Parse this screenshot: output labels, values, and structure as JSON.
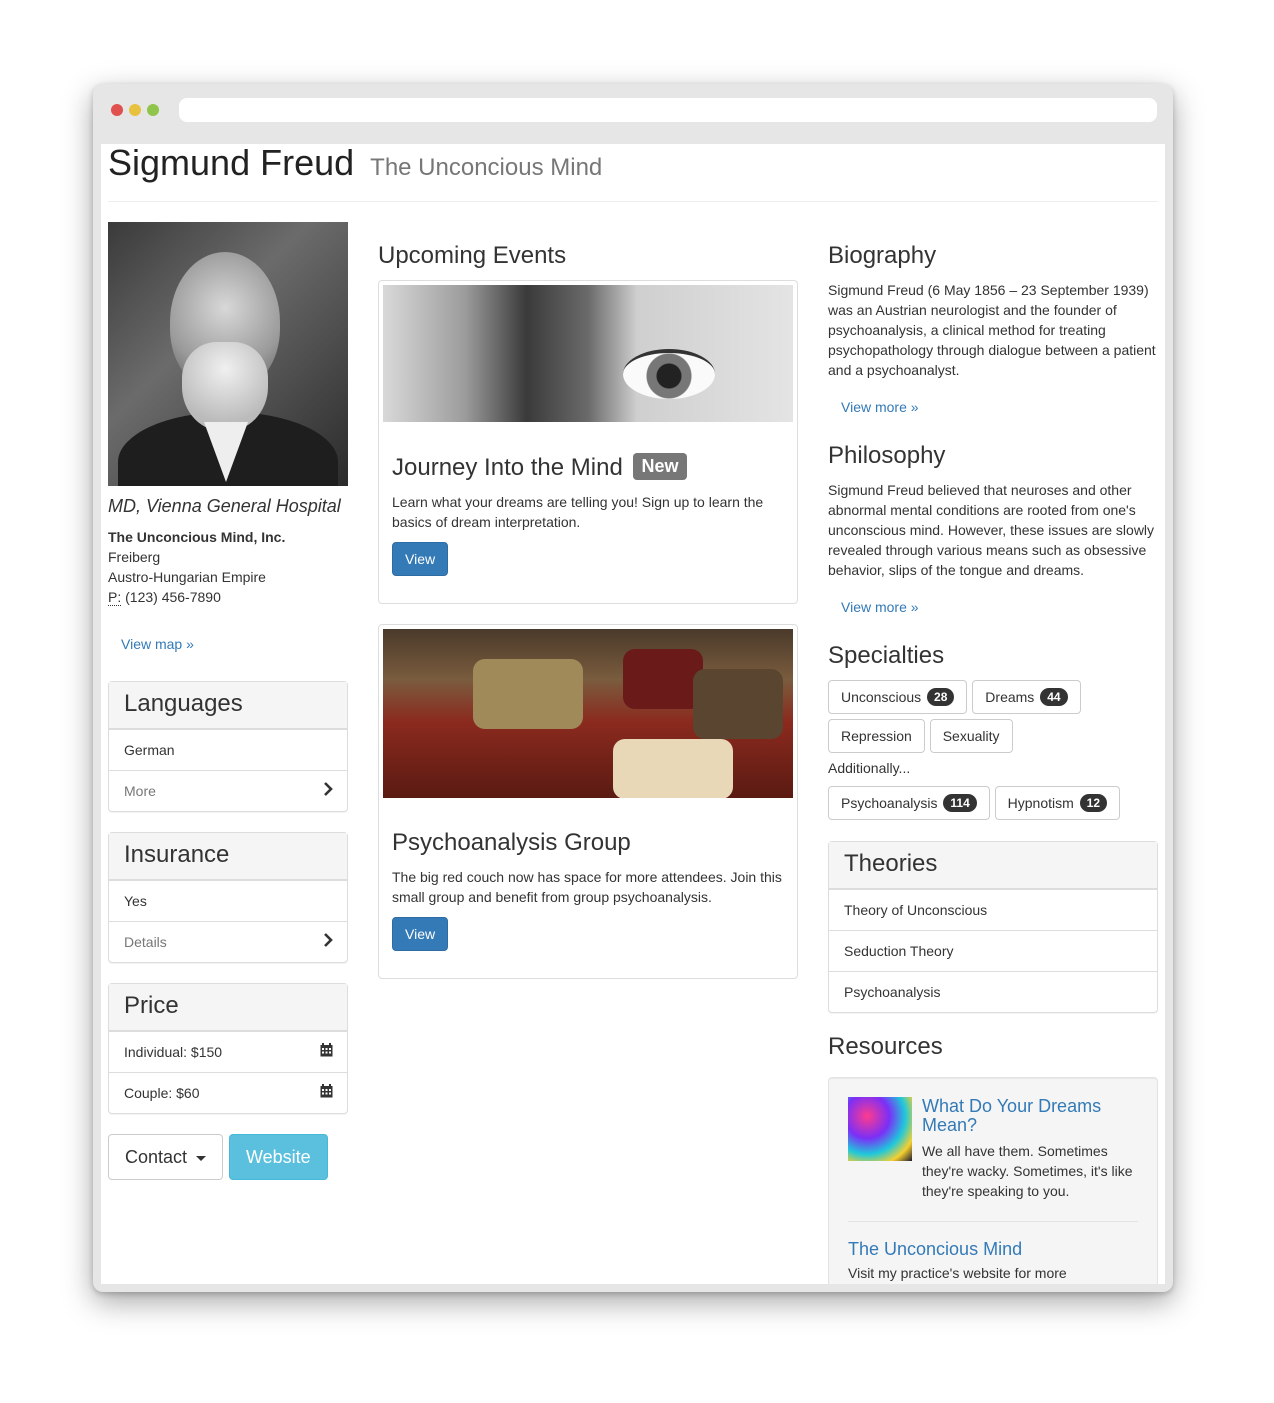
{
  "header": {
    "title": "Sigmund Freud",
    "subtitle": "The Unconcious Mind"
  },
  "profile": {
    "role": "MD, Vienna General Hospital",
    "org": "The Unconcious Mind, Inc.",
    "city": "Freiberg",
    "country": "Austro-Hungarian Empire",
    "phone_label": "P:",
    "phone": "(123) 456-7890",
    "map_link": "View map »"
  },
  "languages": {
    "title": "Languages",
    "items": [
      "German",
      "More"
    ]
  },
  "insurance": {
    "title": "Insurance",
    "items": [
      "Yes",
      "Details"
    ]
  },
  "price": {
    "title": "Price",
    "items": [
      "Individual: $150",
      "Couple: $60"
    ]
  },
  "actions": {
    "contact": "Contact",
    "website": "Website"
  },
  "events": {
    "title": "Upcoming Events",
    "items": [
      {
        "title": "Journey Into the Mind",
        "badge": "New",
        "text": "Learn what your dreams are telling you! Sign up to learn the basics of dream interpretation.",
        "button": "View"
      },
      {
        "title": "Psychoanalysis Group",
        "text": "The big red couch now has space for more attendees. Join this small group and benefit from group psychoanalysis.",
        "button": "View"
      }
    ]
  },
  "biography": {
    "title": "Biography",
    "text": "Sigmund Freud (6 May 1856 – 23 September 1939) was an Austrian neurologist and the founder of psychoanalysis, a clinical method for treating psychopathology through dialogue between a patient and a psychoanalyst.",
    "link": "View more »"
  },
  "philosophy": {
    "title": "Philosophy",
    "text": "Sigmund Freud believed that neuroses and other abnormal mental conditions are rooted from one's unconscious mind. However, these issues are slowly revealed through various means such as obsessive behavior, slips of the tongue and dreams.",
    "link": "View more »"
  },
  "specialties": {
    "title": "Specialties",
    "primary": [
      {
        "label": "Unconscious",
        "count": "28"
      },
      {
        "label": "Dreams",
        "count": "44"
      },
      {
        "label": "Repression"
      },
      {
        "label": "Sexuality"
      }
    ],
    "additional_label": "Additionally...",
    "additional": [
      {
        "label": "Psychoanalysis",
        "count": "114"
      },
      {
        "label": "Hypnotism",
        "count": "12"
      }
    ]
  },
  "theories": {
    "title": "Theories",
    "items": [
      "Theory of Unconscious",
      "Seduction Theory",
      "Psychoanalysis"
    ]
  },
  "resources": {
    "title": "Resources",
    "items": [
      {
        "title": "What Do Your Dreams Mean?",
        "text": "We all have them. Sometimes they're wacky. Sometimes, it's like they're speaking to you."
      },
      {
        "title": "The Unconcious Mind",
        "text": "Visit my practice's website for more"
      }
    ]
  },
  "icons": {
    "chevron": "chevron-right-icon",
    "calendar": "calendar-icon",
    "caret": "caret-down-icon"
  }
}
